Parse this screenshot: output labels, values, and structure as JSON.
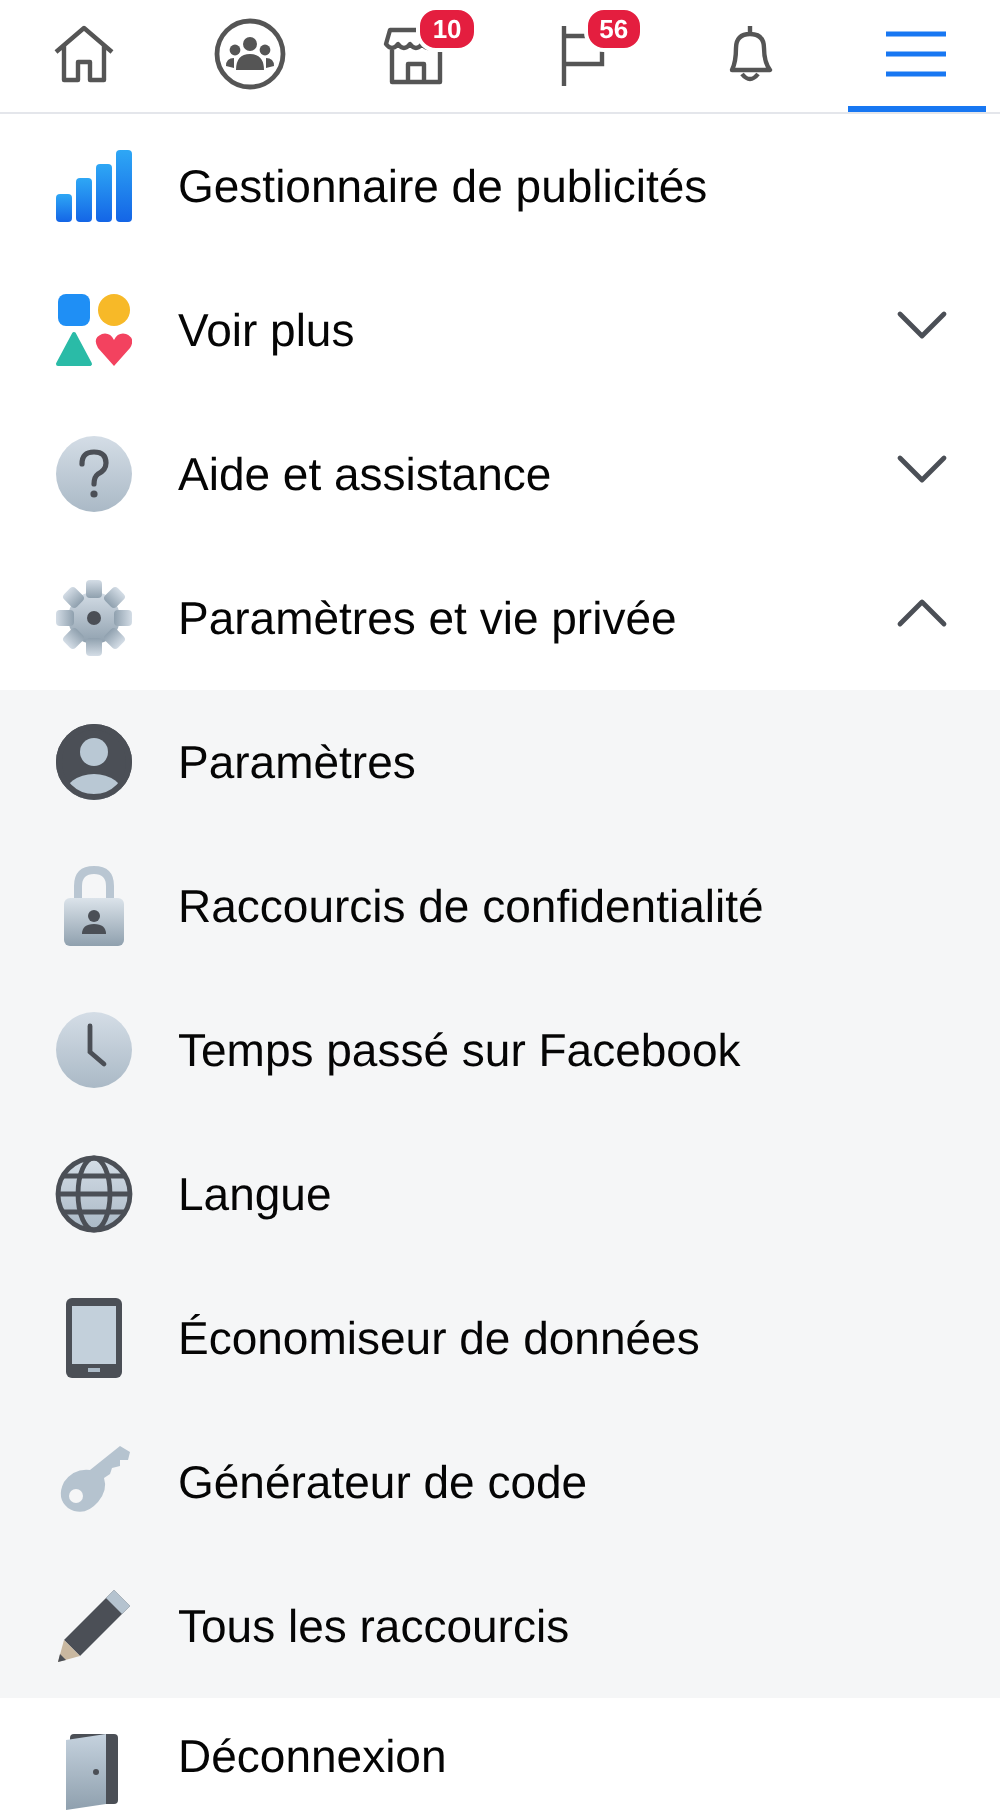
{
  "tabs": [
    {
      "selected": false
    },
    {
      "selected": false
    },
    {
      "selected": false,
      "badge": "10"
    },
    {
      "selected": false,
      "badge": "56"
    },
    {
      "selected": false
    },
    {
      "selected": true
    }
  ],
  "menu": [
    {
      "kind": "link",
      "label": "Gestionnaire de publicités"
    },
    {
      "kind": "expandable",
      "label": "Voir plus",
      "expanded": false
    },
    {
      "kind": "expandable",
      "label": "Aide et assistance",
      "expanded": false
    },
    {
      "kind": "expandable",
      "label": "Paramètres et vie privée",
      "expanded": true,
      "children": [
        {
          "label": "Paramètres"
        },
        {
          "label": "Raccourcis de confidentialité"
        },
        {
          "label": "Temps passé sur Facebook"
        },
        {
          "label": "Langue"
        },
        {
          "label": "Économiseur de données"
        },
        {
          "label": "Générateur de code"
        },
        {
          "label": "Tous les raccourcis"
        }
      ]
    },
    {
      "kind": "link",
      "label": "Déconnexion"
    }
  ]
}
